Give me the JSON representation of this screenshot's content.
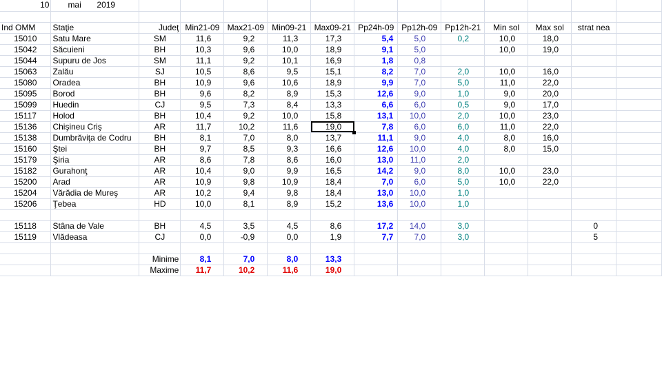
{
  "date": {
    "day": "10",
    "month": "mai",
    "year": "2019"
  },
  "headers": [
    "Ind OMM",
    "Staţie",
    "Judeţ",
    "Min21-09",
    "Max21-09",
    "Min09-21",
    "Max09-21",
    "Pp24h-09",
    "Pp12h-09",
    "Pp12h-21",
    "Min sol",
    "Max sol",
    "strat nea"
  ],
  "rows": [
    [
      "15010",
      "Satu Mare",
      "SM",
      "11,6",
      "9,2",
      "11,3",
      "17,3",
      "5,4",
      "5,0",
      "0,2",
      "10,0",
      "18,0",
      ""
    ],
    [
      "15042",
      "Săcuieni",
      "BH",
      "10,3",
      "9,6",
      "10,0",
      "18,9",
      "9,1",
      "5,0",
      "",
      "10,0",
      "19,0",
      ""
    ],
    [
      "15044",
      "Supuru de Jos",
      "SM",
      "11,1",
      "9,2",
      "10,1",
      "16,9",
      "1,8",
      "0,8",
      "",
      "",
      "",
      ""
    ],
    [
      "15063",
      "Zalău",
      "SJ",
      "10,5",
      "8,6",
      "9,5",
      "15,1",
      "8,2",
      "7,0",
      "2,0",
      "10,0",
      "16,0",
      ""
    ],
    [
      "15080",
      "Oradea",
      "BH",
      "10,9",
      "9,6",
      "10,6",
      "18,9",
      "9,9",
      "7,0",
      "5,0",
      "11,0",
      "22,0",
      ""
    ],
    [
      "15095",
      "Borod",
      "BH",
      "9,6",
      "8,2",
      "8,9",
      "15,3",
      "12,6",
      "9,0",
      "1,0",
      "9,0",
      "20,0",
      ""
    ],
    [
      "15099",
      "Huedin",
      "CJ",
      "9,5",
      "7,3",
      "8,4",
      "13,3",
      "6,6",
      "6,0",
      "0,5",
      "9,0",
      "17,0",
      ""
    ],
    [
      "15117",
      "Holod",
      "BH",
      "10,4",
      "9,2",
      "10,0",
      "15,8",
      "13,1",
      "10,0",
      "2,0",
      "10,0",
      "23,0",
      ""
    ],
    [
      "15136",
      "Chişineu    Criş",
      "AR",
      "11,7",
      "10,2",
      "11,6",
      "19,0",
      "7,8",
      "6,0",
      "6,0",
      "11,0",
      "22,0",
      ""
    ],
    [
      "15138",
      "Dumbrăviţa  de Codru",
      "BH",
      "8,1",
      "7,0",
      "8,0",
      "13,7",
      "11,1",
      "9,0",
      "4,0",
      "8,0",
      "16,0",
      ""
    ],
    [
      "15160",
      "Ştei",
      "BH",
      "9,7",
      "8,5",
      "9,3",
      "16,6",
      "12,6",
      "10,0",
      "4,0",
      "8,0",
      "15,0",
      ""
    ],
    [
      "15179",
      "Şiria",
      "AR",
      "8,6",
      "7,8",
      "8,6",
      "16,0",
      "13,0",
      "11,0",
      "2,0",
      "",
      "",
      ""
    ],
    [
      "15182",
      "Gurahonţ",
      "AR",
      "10,4",
      "9,0",
      "9,9",
      "16,5",
      "14,2",
      "9,0",
      "8,0",
      "10,0",
      "23,0",
      ""
    ],
    [
      "15200",
      "Arad",
      "AR",
      "10,9",
      "9,8",
      "10,9",
      "18,4",
      "7,0",
      "6,0",
      "5,0",
      "10,0",
      "22,0",
      ""
    ],
    [
      "15204",
      "Vărădia de Mureş",
      "AR",
      "10,2",
      "9,4",
      "9,8",
      "18,4",
      "13,0",
      "10,0",
      "1,0",
      "",
      "",
      ""
    ],
    [
      "15206",
      "Ţebea",
      "HD",
      "10,0",
      "8,1",
      "8,9",
      "15,2",
      "13,6",
      "10,0",
      "1,0",
      "",
      "",
      ""
    ]
  ],
  "mountain_rows": [
    [
      "15118",
      "Stâna de Vale",
      "BH",
      "4,5",
      "3,5",
      "4,5",
      "8,6",
      "17,2",
      "14,0",
      "3,0",
      "",
      "",
      "0"
    ],
    [
      "15119",
      "Vlădeasa",
      "CJ",
      "0,0",
      "-0,9",
      "0,0",
      "1,9",
      "7,7",
      "7,0",
      "3,0",
      "",
      "",
      "5"
    ]
  ],
  "summary": {
    "min_label": "Minime",
    "max_label": "Maxime",
    "minime": [
      "8,1",
      "7,0",
      "8,0",
      "13,3"
    ],
    "maxime": [
      "11,7",
      "10,2",
      "11,6",
      "19,0"
    ]
  },
  "selected_cell": {
    "row": 8,
    "col": 6
  },
  "colors": {
    "precip24": "#0000ff",
    "precip12": "#3b3bb0",
    "precip12b": "#008080",
    "max_red": "#e00000",
    "min_blue": "#0000ff",
    "grid": "#d8dde8"
  }
}
